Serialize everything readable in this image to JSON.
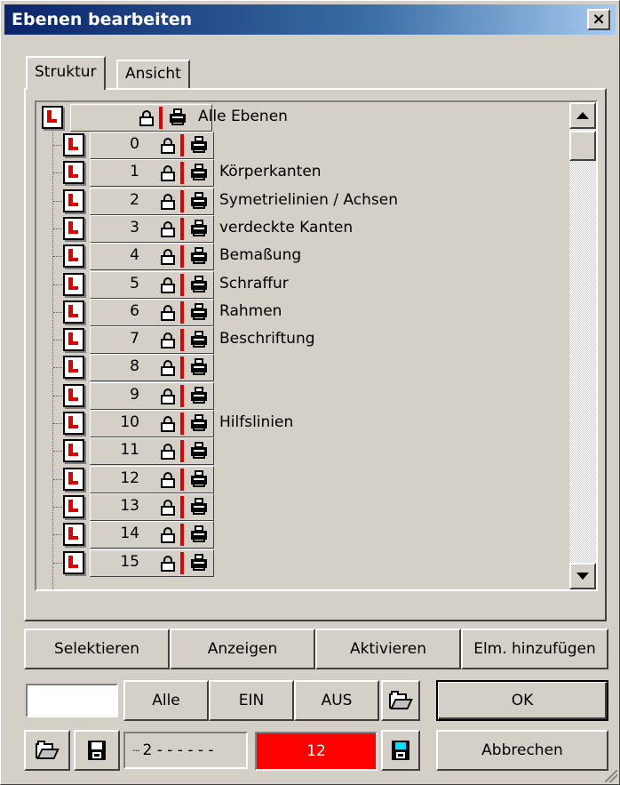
{
  "window": {
    "title": "Ebenen bearbeiten",
    "close_label": "×"
  },
  "tabs": [
    {
      "label": "Struktur"
    },
    {
      "label": "Ansicht"
    }
  ],
  "tree": {
    "root_label": "Alle Ebenen",
    "layers": [
      {
        "num": "0",
        "name": ""
      },
      {
        "num": "1",
        "name": "Körperkanten"
      },
      {
        "num": "2",
        "name": "Symetrielinien / Achsen"
      },
      {
        "num": "3",
        "name": "verdeckte Kanten"
      },
      {
        "num": "4",
        "name": "Bemaßung"
      },
      {
        "num": "5",
        "name": "Schraffur"
      },
      {
        "num": "6",
        "name": "Rahmen"
      },
      {
        "num": "7",
        "name": "Beschriftung"
      },
      {
        "num": "8",
        "name": ""
      },
      {
        "num": "9",
        "name": ""
      },
      {
        "num": "10",
        "name": "Hilfslinien"
      },
      {
        "num": "11",
        "name": ""
      },
      {
        "num": "12",
        "name": ""
      },
      {
        "num": "13",
        "name": ""
      },
      {
        "num": "14",
        "name": ""
      },
      {
        "num": "15",
        "name": ""
      }
    ]
  },
  "actions": {
    "selektieren": "Selektieren",
    "anzeigen": "Anzeigen",
    "aktivieren": "Aktivieren",
    "hinzufuegen": "Elm. hinzufügen"
  },
  "filter": {
    "input_value": "",
    "alle": "Alle",
    "ein": "EIN",
    "aus": "AUS",
    "ok": "OK"
  },
  "bottom": {
    "linetype": "2 - - - - - -",
    "linetype_glyph": "···",
    "color_value": "12",
    "cancel": "Abbrechen"
  },
  "colors": {
    "active_color": "#ff0000",
    "layer_icon_red": "#e00000"
  }
}
